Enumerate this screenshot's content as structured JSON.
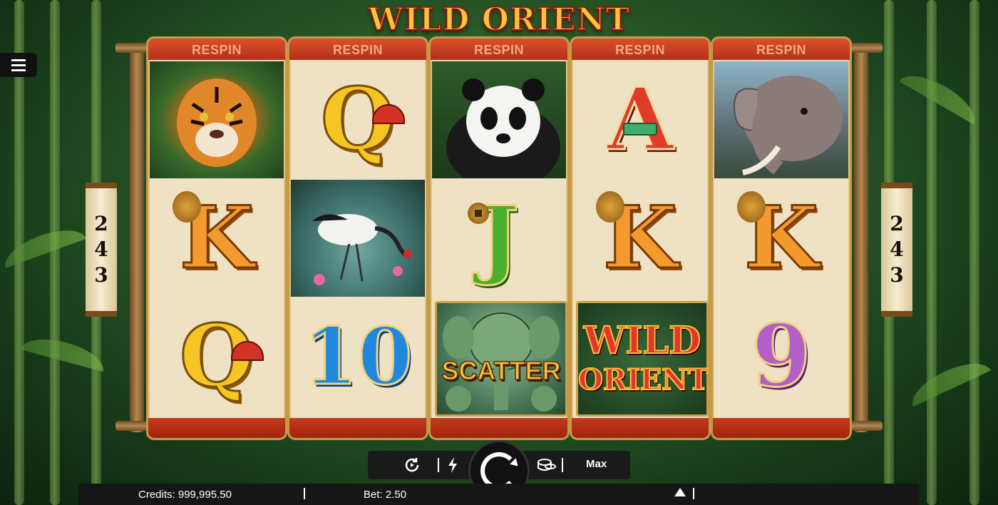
{
  "game": {
    "title": "WILD ORIENT"
  },
  "menu": {
    "icon": "hamburger-menu-icon"
  },
  "reels": [
    {
      "header": "RESPIN",
      "symbols": [
        "tiger",
        "K",
        "Q"
      ]
    },
    {
      "header": "RESPIN",
      "symbols": [
        "Q",
        "crane",
        "10"
      ]
    },
    {
      "header": "RESPIN",
      "symbols": [
        "panda",
        "J",
        "scatter"
      ]
    },
    {
      "header": "RESPIN",
      "symbols": [
        "A",
        "K",
        "wild"
      ]
    },
    {
      "header": "RESPIN",
      "symbols": [
        "elephant",
        "K",
        "9"
      ]
    }
  ],
  "symbol_text": {
    "q": "Q",
    "k": "K",
    "a": "A",
    "j": "J",
    "ten": "10",
    "nine": "9",
    "scatter": "SCATTER",
    "wild_line1": "WILD",
    "wild_line2": "ORIENT"
  },
  "ways": {
    "left": [
      "2",
      "4",
      "3"
    ],
    "right": [
      "2",
      "4",
      "3"
    ]
  },
  "controls": {
    "autoplay_icon": "autoplay-icon",
    "turbo_icon": "lightning-icon",
    "spin_icon": "spin-arrow-icon",
    "coins_icon": "coin-stack-icon",
    "max_label": "Max"
  },
  "status": {
    "credits": "Credits: 999,995.50",
    "bet": "Bet: 2.50"
  }
}
